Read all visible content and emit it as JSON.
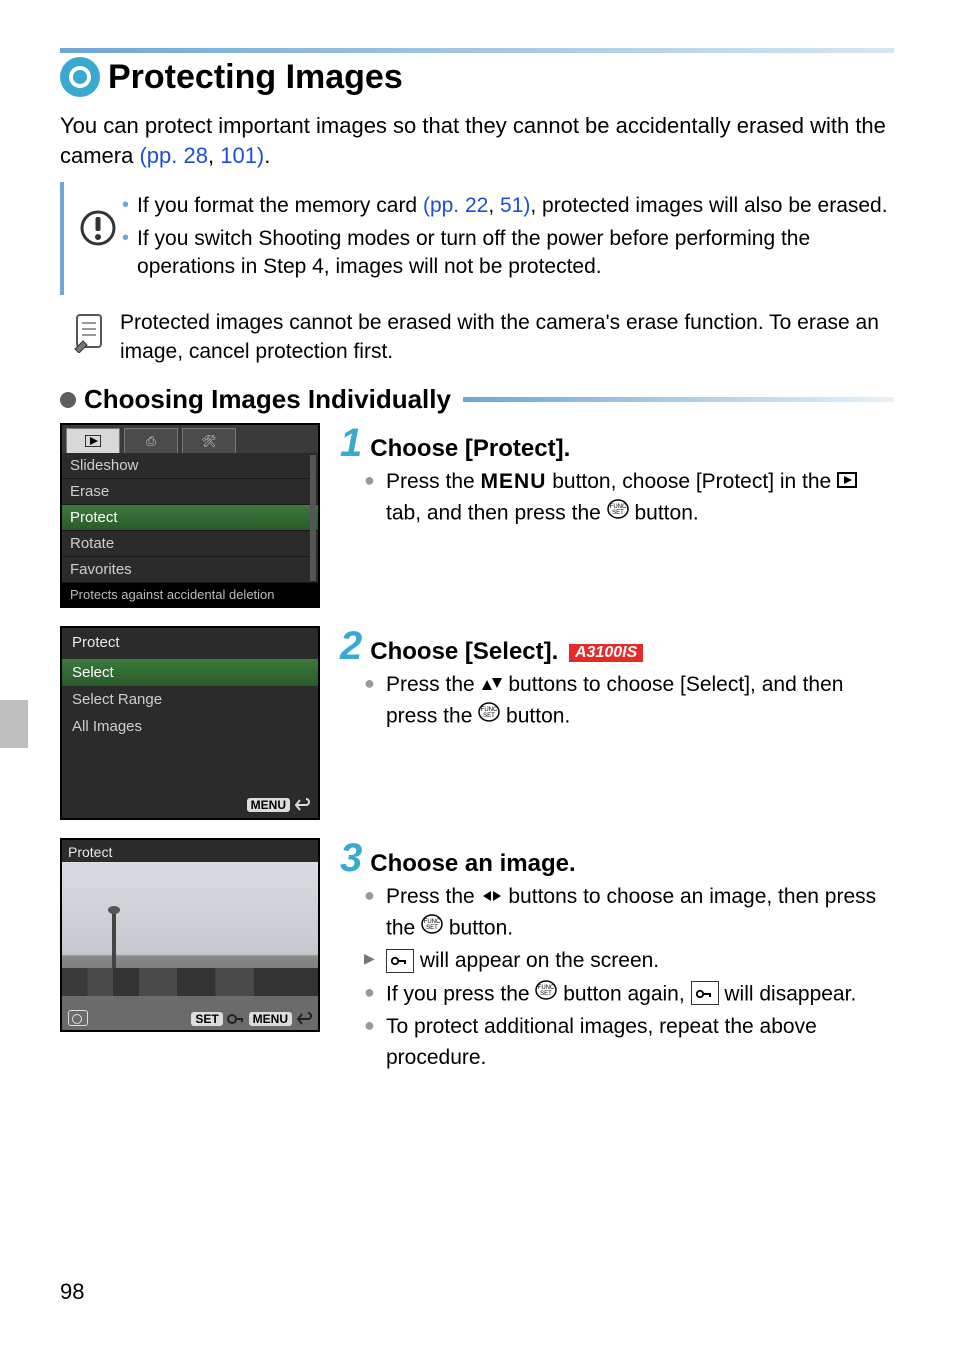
{
  "page_number": "98",
  "title": "Protecting Images",
  "intro_before_link": "You can protect important images so that they cannot be accidentally erased with the camera ",
  "intro_link1_label": "(pp. 28",
  "intro_mid": ", ",
  "intro_link2_label": "101)",
  "intro_after": ".",
  "caution": {
    "item1_a": "If you format the memory card ",
    "item1_link1": "(pp. 22",
    "item1_mid": ", ",
    "item1_link2": "51)",
    "item1_b": ", protected images will also be erased.",
    "item2": "If you switch Shooting modes or turn off the power before performing the operations in Step 4, images will not be protected."
  },
  "note": "Protected images cannot be erased with the camera's erase function. To erase an image, cancel protection first.",
  "subheading": "Choosing Images Individually",
  "step1": {
    "title": "Choose [Protect].",
    "line_a": "Press the ",
    "menu_word": "MENU",
    "line_b": " button, choose [Protect] in the ",
    "line_c": " tab, and then press the ",
    "line_d": " button."
  },
  "shot1": {
    "tab2": "⎙",
    "tab3": "🛠",
    "rows": [
      "Slideshow",
      "Erase",
      "Protect",
      "Rotate",
      "Favorites"
    ],
    "help": "Protects against accidental deletion"
  },
  "step2": {
    "title": "Choose [Select].",
    "badge": "A3100IS",
    "line_a": "Press the ",
    "line_b": " buttons to choose [Select], and then press the ",
    "line_c": " button."
  },
  "shot2": {
    "header": "Protect",
    "rows": [
      "Select",
      "Select Range",
      "All Images"
    ],
    "menu_btn": "MENU"
  },
  "step3": {
    "title": "Choose an image.",
    "l1a": "Press the ",
    "l1b": " buttons to choose an image, then press the ",
    "l1c": " button.",
    "l2a": " will appear on the screen.",
    "l3a": "If you press the ",
    "l3b": " button again, ",
    "l3c": " will disappear.",
    "l4": "To protect additional images, repeat the above procedure."
  },
  "shot3": {
    "header": "Protect",
    "set": "SET",
    "menu": "MENU"
  }
}
